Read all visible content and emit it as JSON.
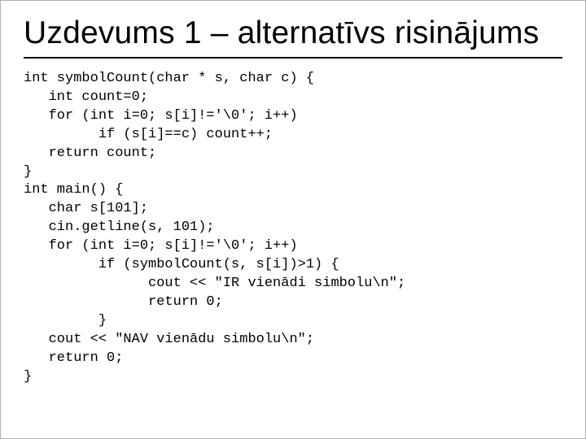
{
  "title": "Uzdevums 1 – alternatīvs risinājums",
  "code": "int symbolCount(char * s, char c) {\n   int count=0;\n   for (int i=0; s[i]!='\\0'; i++)\n         if (s[i]==c) count++;\n   return count;\n}\nint main() {\n   char s[101];\n   cin.getline(s, 101);\n   for (int i=0; s[i]!='\\0'; i++)\n         if (symbolCount(s, s[i])>1) {\n               cout << \"IR vienādi simbolu\\n\";\n               return 0;\n         }\n   cout << \"NAV vienādu simbolu\\n\";\n   return 0;\n}"
}
